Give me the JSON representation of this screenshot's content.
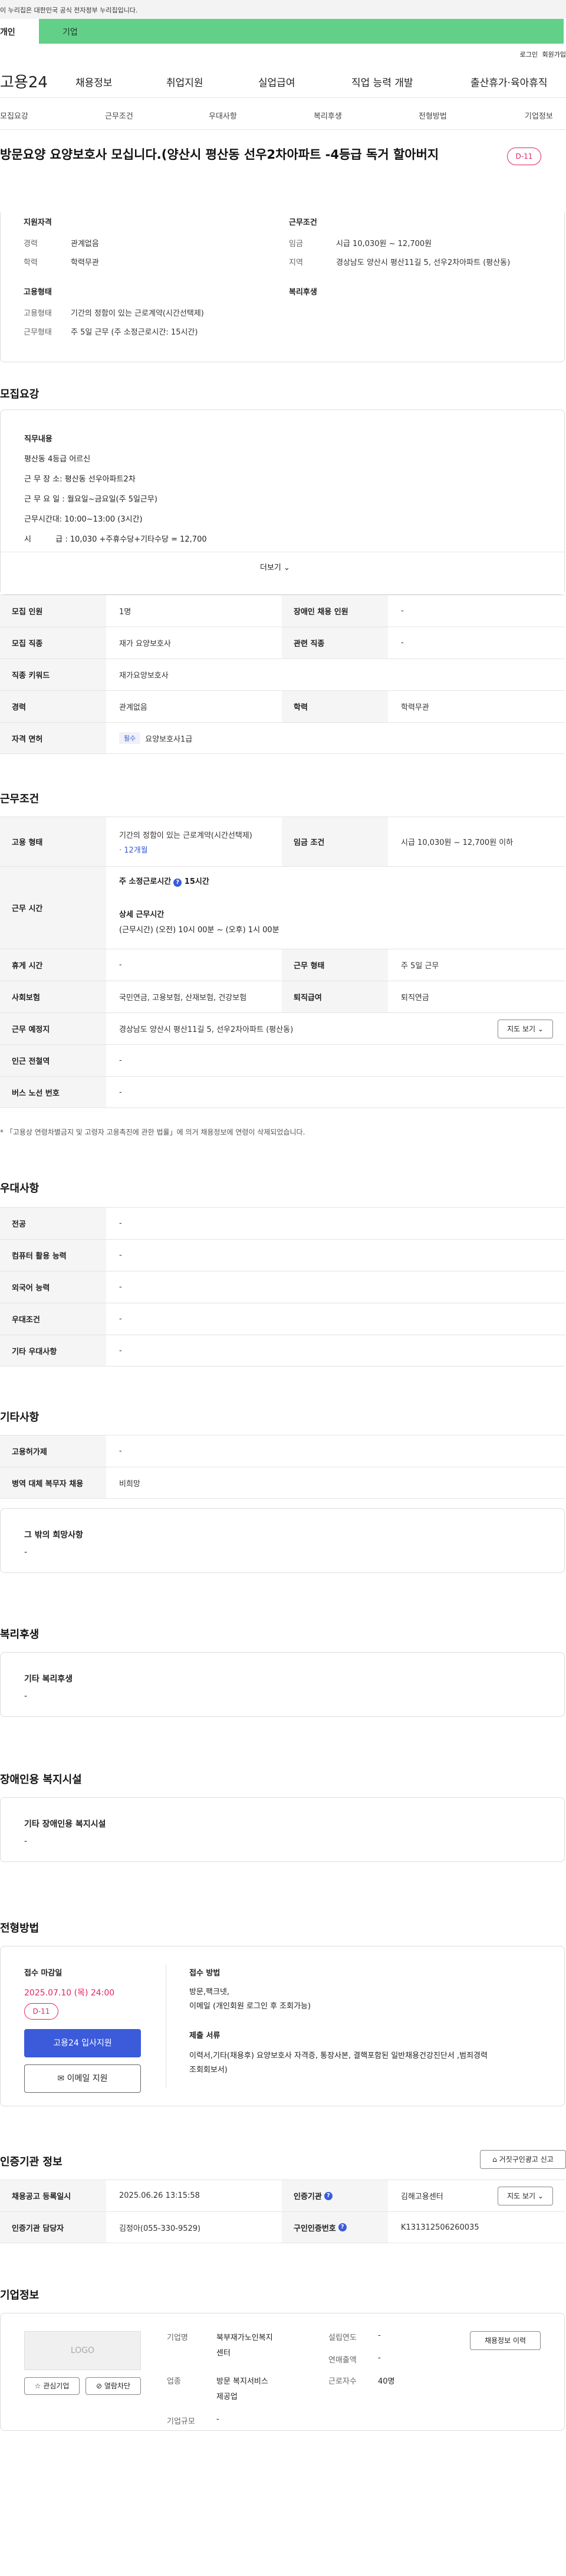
{
  "gov_banner": "이 누리집은 대한민국 공식 전자정부 누리집입니다.",
  "service_tabs": {
    "personal": "개인",
    "corporate": "기업"
  },
  "util": {
    "login": "로그인",
    "join": "회원가입"
  },
  "logo": "고용24",
  "gnb": [
    "채용정보",
    "취업지원",
    "실업급여",
    "직업 능력 개발",
    "출산휴가·육아휴직"
  ],
  "tabs": [
    "모집요강",
    "근무조건",
    "우대사항",
    "복리후생",
    "전형방법",
    "기업정보"
  ],
  "title": "방문요양 요양보호사 모십니다.(양산시 평산동 선우2차아파트 -4등급 독거 할아버지",
  "dday": "D-11",
  "summary": {
    "qual_head": "지원자격",
    "career_k": "경력",
    "career_v": "관계없음",
    "edu_k": "학력",
    "edu_v": "학력무관",
    "emp_head": "고용형태",
    "emptype_k": "고용형태",
    "emptype_v": "기간의 정함이 있는 근로계약(시간선택제)",
    "worktype_k": "근무형태",
    "worktype_v": "주 5일 근무 (주 소정근로시간: 15시간)",
    "cond_head": "근무조건",
    "wage_k": "임금",
    "wage_v": "시급 10,030원 ~ 12,700원",
    "loc_k": "지역",
    "loc_v": "경상남도 양산시 평산11길 5, 선우2차아파트 (평산동)",
    "welfare_head": "복리후생"
  },
  "recruit": {
    "section": "모집요강",
    "duty_head": "직무내용",
    "duty_lines": [
      "평산동 4등급 어르신",
      "근 무 장 소: 평산동 선우아파트2차",
      "근 무 요 일 : 월요일~금요일(주 5일근무)",
      "근무시간대: 10:00~13:00 (3시간)",
      "시          급 : 10,030 +주휴수당+기타수당 = 12,700"
    ],
    "more": "더보기",
    "rows": [
      {
        "k1": "모집 인원",
        "v1": "1명",
        "k2": "장애인 채용 인원",
        "v2": "-"
      },
      {
        "k1": "모집 직종",
        "v1": "재가 요양보호사",
        "k2": "관련 직종",
        "v2": "-"
      },
      {
        "k1": "직종 키워드",
        "v1": "재가요양보호사"
      },
      {
        "k1": "경력",
        "v1": "관계없음",
        "k2": "학력",
        "v2": "학력무관"
      }
    ],
    "license_k": "자격 면허",
    "license_tag": "필수",
    "license_v": "요양보호사1급"
  },
  "work": {
    "section": "근무조건",
    "emp_k": "고용 형태",
    "emp_v1": "기간의 정함이 있는 근로계약(시간선택제)",
    "emp_v2": "· 12개월",
    "wage_k": "임금 조건",
    "wage_v": "시급 10,030원 ~ 12,700원 이하",
    "hours_k": "근무 시간",
    "hours_a": "주 소정근로시간",
    "hours_b": "15시간",
    "hours_detail_head": "상세 근무시간",
    "hours_detail": "(근무시간) (오전) 10시 00분 ~ (오후) 1시 00분",
    "rest_k": "휴게 시간",
    "rest_v": "-",
    "form_k": "근무 형태",
    "form_v": "주 5일 근무",
    "ins_k": "사회보험",
    "ins_v": "국민연금, 고용보험, 산재보험, 건강보험",
    "pension_k": "퇴직급여",
    "pension_v": "퇴직연금",
    "place_k": "근무 예정지",
    "place_v": "경상남도 양산시 평산11길 5, 선우2차아파트 (평산동)",
    "map_btn": "지도 보기",
    "subway_k": "인근 전철역",
    "subway_v": "-",
    "bus_k": "버스 노선 번호",
    "bus_v": "-",
    "note": "* 「고용상 연령차별금지 및 고령자 고용촉진에 관한 법률」에 의거 채용정보에 연령이 삭제되었습니다."
  },
  "pref": {
    "section": "우대사항",
    "rows": [
      [
        "전공",
        "-"
      ],
      [
        "컴퓨터 활용 능력",
        "-"
      ],
      [
        "외국어 능력",
        "-"
      ],
      [
        "우대조건",
        "-"
      ],
      [
        "기타 우대사항",
        "-"
      ]
    ]
  },
  "etc": {
    "section": "기타사항",
    "rows": [
      [
        "고용허가제",
        "-"
      ],
      [
        "병역 대체 복무자 채용",
        "비희망"
      ]
    ],
    "other_head": "그 밖의 희망사항",
    "other_v": "-"
  },
  "welfare": {
    "section": "복리후생",
    "head": "기타 복리후생",
    "v": "-"
  },
  "disabled": {
    "section": "장애인용 복지시설",
    "head": "기타 장애인용 복지시설",
    "v": "-"
  },
  "screening": {
    "section": "전형방법",
    "deadline_head": "접수 마감일",
    "deadline": "2025.07.10 (목) 24:00",
    "dday": "D-11",
    "apply_btn": "고용24 입사지원",
    "email_btn": "이메일 지원",
    "method_head": "접수 방법",
    "method_v1": "방문,팩크넷,",
    "method_v2": "이메일 (개인회원 로그인 후 조회가능)",
    "docs_head": "제출 서류",
    "docs_v1": "이력서,기타(채용후) 요양보호사 자격증, 통장사본, 결핵포함된 일반채용건강진단서 ,범죄경력",
    "docs_v2": "조회회보서)"
  },
  "cert": {
    "section": "인증기관 정보",
    "report_btn": "거짓구인광고 신고",
    "reg_k": "채용공고 등록일시",
    "reg_v": "2025.06.26 13:15:58",
    "org_k": "인증기관",
    "org_v": "김해고용센터",
    "map_btn": "지도 보기",
    "mgr_k": "인증기관 담당자",
    "mgr_v": "김정아(055-330-9529)",
    "no_k": "구인인증번호",
    "no_v": "K131312506260035"
  },
  "company": {
    "section": "기업정보",
    "logo": "LOGO",
    "fav_btn": "관심기업",
    "block_btn": "열람차단",
    "jobs_btn": "채용정보 이력",
    "name_k": "기업명",
    "name_v1": "북부재가노인복지",
    "name_v2": "센터",
    "ind_k": "업종",
    "ind_v1": "방문 복지서비스",
    "ind_v2": "제공업",
    "size_k": "기업규모",
    "size_v": "-",
    "est_k": "설립연도",
    "est_v": "-",
    "sales_k": "연매출액",
    "sales_v": "-",
    "staff_k": "근로자수",
    "staff_v": "40명"
  }
}
